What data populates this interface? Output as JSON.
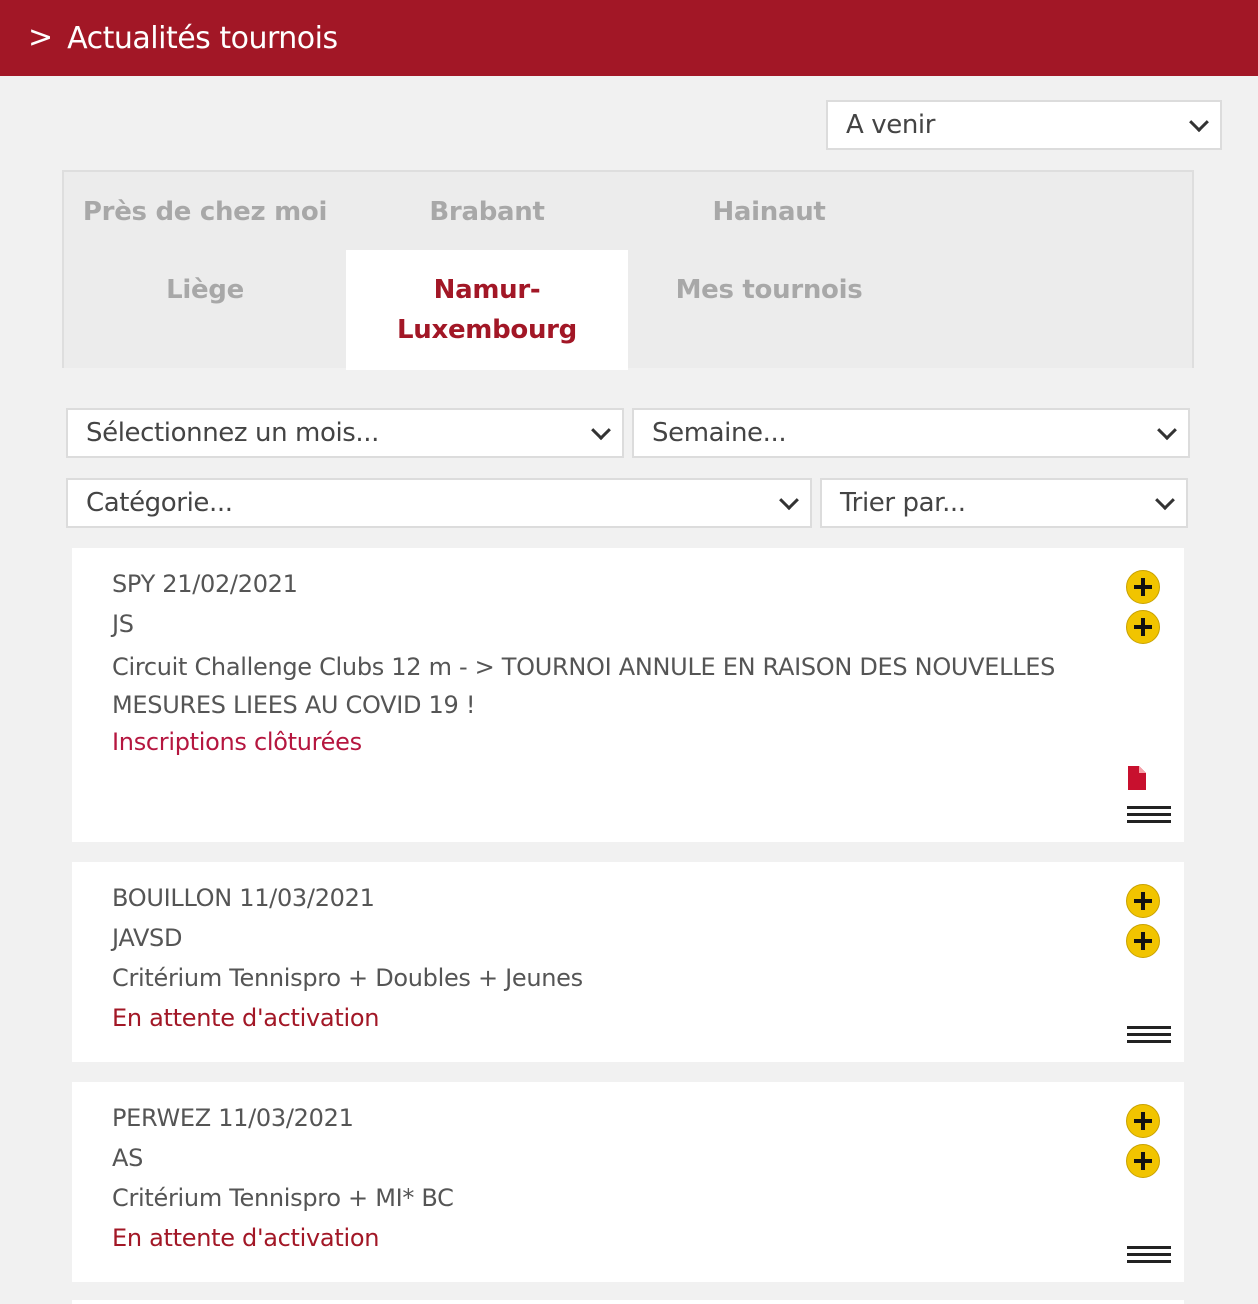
{
  "header": {
    "chevron": ">",
    "title": "Actualités tournois"
  },
  "period_select": {
    "value": "A venir"
  },
  "tabs": [
    {
      "label": "Près de chez moi"
    },
    {
      "label": "Brabant"
    },
    {
      "label": "Hainaut"
    },
    {
      "label": "Liège"
    },
    {
      "label": "Namur-Luxembourg",
      "line1": "Namur-",
      "line2": "Luxembourg",
      "active": true
    },
    {
      "label": "Mes tournois"
    }
  ],
  "filters": {
    "month": "Sélectionnez un mois...",
    "week": "Semaine...",
    "category": "Catégorie...",
    "sort": "Trier par..."
  },
  "tournaments": [
    {
      "title": "SPY 21/02/2021",
      "code": "JS",
      "description": "Circuit Challenge Clubs 12 m - > TOURNOI ANNULE EN RAISON DES NOUVELLES MESURES LIEES AU COVID 19 !",
      "status": "Inscriptions clôturées"
    },
    {
      "title": "BOUILLON 11/03/2021",
      "code": "JAVSD",
      "description": "Critérium Tennispro + Doubles + Jeunes",
      "status": "En attente d'activation"
    },
    {
      "title": "PERWEZ 11/03/2021",
      "code": "AS",
      "description": "Critérium Tennispro + MI* BC",
      "status": "En attente d'activation"
    }
  ],
  "colors": {
    "brand": "#a21726",
    "plus_icon": "#f1c400",
    "background": "#f1f1f1"
  }
}
